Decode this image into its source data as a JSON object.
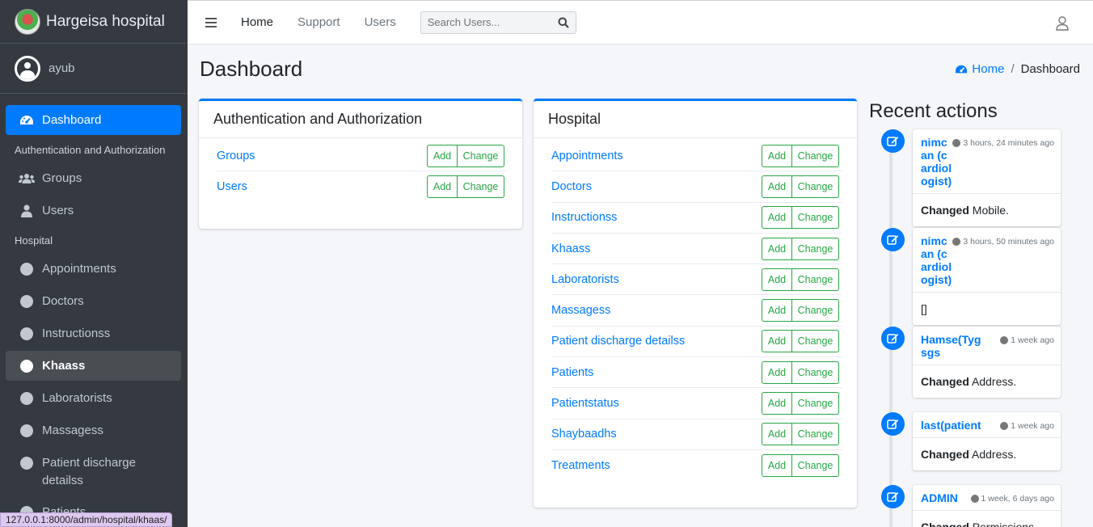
{
  "brand": {
    "name": "Hargeisa hospital"
  },
  "user": {
    "name": "ayub"
  },
  "sidebar": {
    "dashboard": "Dashboard",
    "section_auth": "Authentication and Authorization",
    "auth_items": [
      "Groups",
      "Users"
    ],
    "section_hospital": "Hospital",
    "hospital_items": [
      "Appointments",
      "Doctors",
      "Instructionss",
      "Khaass",
      "Laboratorists",
      "Massagess",
      "Patient discharge detailss"
    ],
    "partial_item": "Patients",
    "current_item": "Khaass"
  },
  "topbar": {
    "links": [
      "Home",
      "Support",
      "Users"
    ],
    "search_placeholder": "Search Users..."
  },
  "page": {
    "title": "Dashboard"
  },
  "breadcrumb": {
    "home": "Home",
    "current": "Dashboard"
  },
  "auth_card": {
    "title": "Authentication and Authorization",
    "models": [
      "Groups",
      "Users"
    ]
  },
  "hospital_card": {
    "title": "Hospital",
    "models": [
      "Appointments",
      "Doctors",
      "Instructionss",
      "Khaass",
      "Laboratorists",
      "Massagess",
      "Patient discharge detailss",
      "Patients",
      "Patientstatus",
      "Shaybaadhs",
      "Treatments"
    ]
  },
  "buttons": {
    "add": "Add",
    "change": "Change"
  },
  "recent": {
    "title": "Recent actions",
    "items": [
      {
        "name": "nimcan (cardiologist)",
        "time": "3 hours, 24 minutes ago",
        "bold": "Changed",
        "text": " Mobile."
      },
      {
        "name": "nimcan (cardiologist)",
        "time": "3 hours, 50 minutes ago",
        "bold": "",
        "text": "[]"
      },
      {
        "name": "Hamse(Tygsgs",
        "time": "1 week ago",
        "bold": "Changed",
        "text": " Address."
      },
      {
        "name": "last(patient",
        "time": "1 week ago",
        "bold": "Changed",
        "text": " Address."
      },
      {
        "name": "ADMIN",
        "time": "1 week, 6 days ago",
        "bold": "Changed",
        "text": " Permissions."
      }
    ]
  },
  "statusbar": {
    "url": "127.0.0.1:8000/admin/hospital/khaas/"
  },
  "colors": {
    "primary": "#007bff",
    "success": "#28a745",
    "sidebar": "#343a40"
  }
}
